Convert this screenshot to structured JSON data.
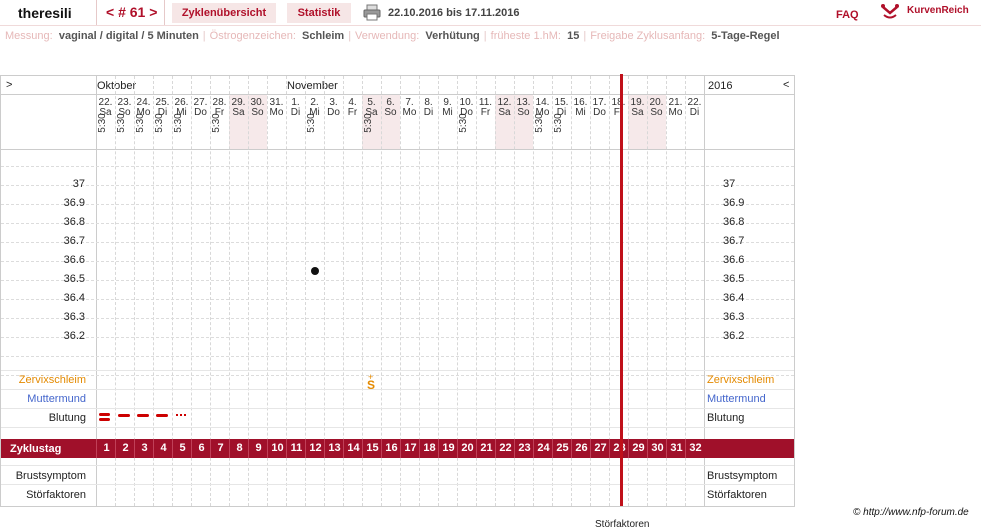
{
  "header": {
    "username": "theresili",
    "cycle_nav": "< # 61 >",
    "tab_overview": "Zyklenübersicht",
    "tab_stats": "Statistik",
    "date_range": "22.10.2016 bis 17.11.2016",
    "faq": "FAQ",
    "brand": "KurvenReich"
  },
  "params": [
    {
      "label": "Messung:",
      "value": "vaginal / digital / 5 Minuten"
    },
    {
      "label": "Östrogenzeichen:",
      "value": "Schleim"
    },
    {
      "label": "Verwendung:",
      "value": "Verhütung"
    },
    {
      "label": "früheste 1.hM:",
      "value": "15"
    },
    {
      "label": "Freigabe Zyklusanfang:",
      "value": "5-Tage-Regel"
    }
  ],
  "chart": {
    "nav_prev": ">",
    "nav_next": "<",
    "month1": "Oktober",
    "month2": "November",
    "year": "2016",
    "days": [
      {
        "d": "22.",
        "w": "Sa",
        "t": "5:30",
        "we": false
      },
      {
        "d": "23.",
        "w": "So",
        "t": "5:30",
        "we": false
      },
      {
        "d": "24.",
        "w": "Mo",
        "t": "5:30",
        "we": false
      },
      {
        "d": "25.",
        "w": "Di",
        "t": "5:30",
        "we": false
      },
      {
        "d": "26.",
        "w": "Mi",
        "t": "5:30",
        "we": false
      },
      {
        "d": "27.",
        "w": "Do",
        "t": "",
        "we": false
      },
      {
        "d": "28.",
        "w": "Fr",
        "t": "5:30",
        "we": false
      },
      {
        "d": "29.",
        "w": "Sa",
        "t": "",
        "we": true
      },
      {
        "d": "30.",
        "w": "So",
        "t": "",
        "we": true
      },
      {
        "d": "31.",
        "w": "Mo",
        "t": "",
        "we": false
      },
      {
        "d": "1.",
        "w": "Di",
        "t": "",
        "we": false
      },
      {
        "d": "2.",
        "w": "Mi",
        "t": "5:30",
        "we": false
      },
      {
        "d": "3.",
        "w": "Do",
        "t": "",
        "we": false
      },
      {
        "d": "4.",
        "w": "Fr",
        "t": "",
        "we": false
      },
      {
        "d": "5.",
        "w": "Sa",
        "t": "5:30",
        "we": true
      },
      {
        "d": "6.",
        "w": "So",
        "t": "",
        "we": true
      },
      {
        "d": "7.",
        "w": "Mo",
        "t": "",
        "we": false
      },
      {
        "d": "8.",
        "w": "Di",
        "t": "",
        "we": false
      },
      {
        "d": "9.",
        "w": "Mi",
        "t": "",
        "we": false
      },
      {
        "d": "10.",
        "w": "Do",
        "t": "5:30",
        "we": false
      },
      {
        "d": "11.",
        "w": "Fr",
        "t": "",
        "we": false
      },
      {
        "d": "12.",
        "w": "Sa",
        "t": "",
        "we": true
      },
      {
        "d": "13.",
        "w": "So",
        "t": "",
        "we": true
      },
      {
        "d": "14.",
        "w": "Mo",
        "t": "5:30",
        "we": false
      },
      {
        "d": "15.",
        "w": "Di",
        "t": "5:30",
        "we": false
      },
      {
        "d": "16.",
        "w": "Mi",
        "t": "",
        "we": false
      },
      {
        "d": "17.",
        "w": "Do",
        "t": "",
        "we": false
      },
      {
        "d": "18.",
        "w": "Fr",
        "t": "",
        "we": false
      },
      {
        "d": "19.",
        "w": "Sa",
        "t": "",
        "we": true
      },
      {
        "d": "20.",
        "w": "So",
        "t": "",
        "we": true
      },
      {
        "d": "21.",
        "w": "Mo",
        "t": "",
        "we": false
      },
      {
        "d": "22.",
        "w": "Di",
        "t": "",
        "we": false
      }
    ],
    "temps_left": [
      "37",
      "36.9",
      "36.8",
      "36.7",
      "36.6",
      "36.5",
      "36.4",
      "36.3",
      "36.2"
    ],
    "temps_right": [
      "37",
      "36.9",
      "36.8",
      "36.7",
      "36.6",
      "36.5",
      "36.4",
      "36.3",
      "36.2"
    ],
    "temperature_points": [
      {
        "day_index": 11,
        "value": 36.55
      }
    ],
    "row_zervix": "Zervixschleim",
    "row_muttermund": "Muttermund",
    "row_blutung": "Blutung",
    "row_zyklustag": "Zyklustag",
    "row_brust": "Brustsymptom",
    "row_stoer": "Störfaktoren",
    "zervix_mark": {
      "day_index": 14,
      "symbol": "S",
      "plus": "+"
    },
    "bleeding_days": [
      0,
      1,
      2,
      3,
      4
    ],
    "cycle_days": [
      "1",
      "2",
      "3",
      "4",
      "5",
      "6",
      "7",
      "8",
      "9",
      "10",
      "11",
      "12",
      "13",
      "14",
      "15",
      "16",
      "17",
      "18",
      "19",
      "20",
      "21",
      "22",
      "23",
      "24",
      "25",
      "26",
      "27",
      "28",
      "29",
      "30",
      "31",
      "32"
    ],
    "current_day_index": 27
  },
  "footer": {
    "copyright": "© http://www.nfp-forum.de",
    "cut_label": "Störfaktoren"
  },
  "colors": {
    "accent": "#b0102a",
    "zervix": "#e48a00",
    "muttermund": "#4466cc",
    "bleeding": "#cc0000",
    "weekend": "#f6e9ea"
  }
}
